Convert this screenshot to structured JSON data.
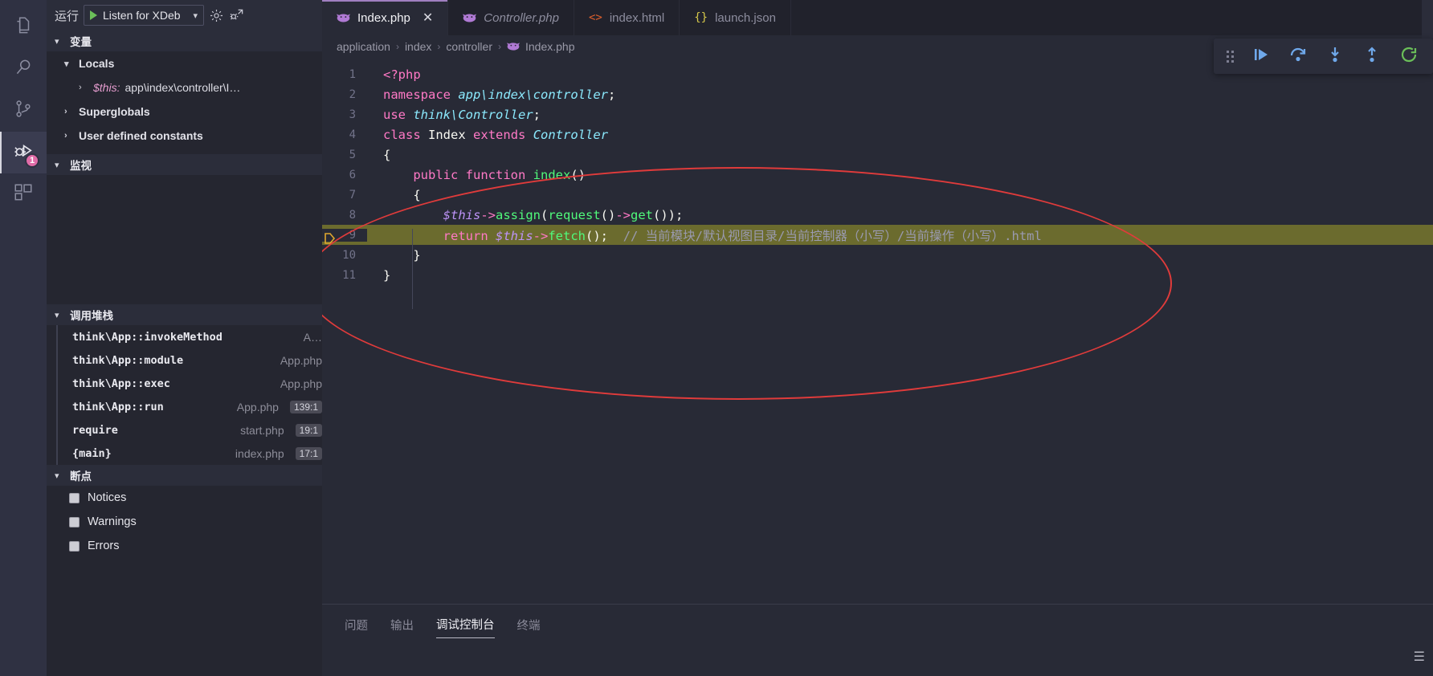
{
  "activitybar": {
    "items": [
      {
        "name": "explorer",
        "icon": "files-icon",
        "active": false
      },
      {
        "name": "search",
        "icon": "search-icon",
        "active": false
      },
      {
        "name": "source-control",
        "icon": "source-control-icon",
        "active": false
      },
      {
        "name": "run-and-debug",
        "icon": "debug-icon",
        "active": true,
        "badge": "1"
      },
      {
        "name": "extensions",
        "icon": "extensions-icon",
        "active": false
      }
    ]
  },
  "sidebar": {
    "run_label": "运行",
    "configuration": "Listen for XDeb",
    "gear_icon": "gear-icon",
    "open_debug_icon": "open-debug-console-icon",
    "sections": {
      "variables": {
        "title": "变量",
        "rows": [
          {
            "label": "Locals",
            "twisty": "⌄",
            "bold": true,
            "indent": 0
          },
          {
            "label": "$this:",
            "value": "app\\index\\controller\\I…",
            "twisty": "›",
            "bold": false,
            "indent": 1,
            "isVar": true
          },
          {
            "label": "Superglobals",
            "twisty": "›",
            "bold": true,
            "indent": 0
          },
          {
            "label": "User defined constants",
            "twisty": "›",
            "bold": true,
            "indent": 0
          }
        ]
      },
      "watch": {
        "title": "监视",
        "rows": []
      },
      "callstack": {
        "title": "调用堆栈",
        "rows": [
          {
            "name": "think\\App::invokeMethod",
            "file": "A…",
            "line": ""
          },
          {
            "name": "think\\App::module",
            "file": "App.php",
            "line": ""
          },
          {
            "name": "think\\App::exec",
            "file": "App.php",
            "line": ""
          },
          {
            "name": "think\\App::run",
            "file": "App.php",
            "line": "139:1"
          },
          {
            "name": "require",
            "file": "start.php",
            "line": "19:1"
          },
          {
            "name": "{main}",
            "file": "index.php",
            "line": "17:1"
          }
        ]
      },
      "breakpoints": {
        "title": "断点",
        "rows": [
          {
            "label": "Notices",
            "checked": false
          },
          {
            "label": "Warnings",
            "checked": false
          },
          {
            "label": "Errors",
            "checked": false
          }
        ]
      }
    }
  },
  "editor": {
    "tabs": [
      {
        "label": "Index.php",
        "icon": "php-icon",
        "active": true,
        "italic": false,
        "closable": true
      },
      {
        "label": "Controller.php",
        "icon": "php-icon",
        "active": false,
        "italic": true,
        "closable": false
      },
      {
        "label": "index.html",
        "icon": "html-icon",
        "active": false,
        "italic": false,
        "closable": false
      },
      {
        "label": "launch.json",
        "icon": "json-icon",
        "active": false,
        "italic": false,
        "closable": false
      }
    ],
    "breadcrumb": [
      "application",
      "index",
      "controller",
      "Index.php"
    ],
    "breadcrumb_separator": "›",
    "lines": [
      {
        "num": "1",
        "highlight": false,
        "breakpoint": false,
        "tokens": [
          {
            "t": "tag",
            "s": "<?php"
          }
        ]
      },
      {
        "num": "2",
        "highlight": false,
        "breakpoint": false,
        "tokens": [
          {
            "t": "kw",
            "s": "namespace"
          },
          {
            "t": "plain",
            "s": " "
          },
          {
            "t": "id",
            "s": "app\\index\\controller"
          },
          {
            "t": "pun",
            "s": ";"
          }
        ]
      },
      {
        "num": "3",
        "highlight": false,
        "breakpoint": false,
        "tokens": [
          {
            "t": "kw",
            "s": "use"
          },
          {
            "t": "plain",
            "s": " "
          },
          {
            "t": "id",
            "s": "think\\Controller"
          },
          {
            "t": "pun",
            "s": ";"
          }
        ]
      },
      {
        "num": "4",
        "highlight": false,
        "breakpoint": false,
        "tokens": [
          {
            "t": "kw",
            "s": "class"
          },
          {
            "t": "plain",
            "s": " "
          },
          {
            "t": "plain",
            "s": "Index"
          },
          {
            "t": "plain",
            "s": " "
          },
          {
            "t": "kw",
            "s": "extends"
          },
          {
            "t": "plain",
            "s": " "
          },
          {
            "t": "cls",
            "s": "Controller"
          }
        ]
      },
      {
        "num": "5",
        "highlight": false,
        "breakpoint": false,
        "tokens": [
          {
            "t": "plain",
            "s": "{"
          }
        ]
      },
      {
        "num": "6",
        "highlight": false,
        "breakpoint": false,
        "tokens": [
          {
            "t": "plain",
            "s": "    "
          },
          {
            "t": "kw",
            "s": "public"
          },
          {
            "t": "plain",
            "s": " "
          },
          {
            "t": "kw",
            "s": "function"
          },
          {
            "t": "plain",
            "s": " "
          },
          {
            "t": "fn",
            "s": "index"
          },
          {
            "t": "pun",
            "s": "()"
          }
        ]
      },
      {
        "num": "7",
        "highlight": false,
        "breakpoint": false,
        "tokens": [
          {
            "t": "plain",
            "s": "    {"
          }
        ]
      },
      {
        "num": "8",
        "highlight": false,
        "breakpoint": false,
        "tokens": [
          {
            "t": "plain",
            "s": "        "
          },
          {
            "t": "var",
            "s": "$this"
          },
          {
            "t": "op",
            "s": "->"
          },
          {
            "t": "fn",
            "s": "assign"
          },
          {
            "t": "pun",
            "s": "("
          },
          {
            "t": "fn",
            "s": "request"
          },
          {
            "t": "pun",
            "s": "()"
          },
          {
            "t": "op",
            "s": "->"
          },
          {
            "t": "fn",
            "s": "get"
          },
          {
            "t": "pun",
            "s": "());"
          }
        ]
      },
      {
        "num": "9",
        "highlight": true,
        "breakpoint": true,
        "tokens": [
          {
            "t": "plain",
            "s": "        "
          },
          {
            "t": "kw",
            "s": "return"
          },
          {
            "t": "plain",
            "s": " "
          },
          {
            "t": "var",
            "s": "$this"
          },
          {
            "t": "op",
            "s": "->"
          },
          {
            "t": "fn",
            "s": "fetch"
          },
          {
            "t": "pun",
            "s": "();"
          },
          {
            "t": "plain",
            "s": "  "
          },
          {
            "t": "cmt",
            "s": "// 当前模块/默认视图目录/当前控制器（小写）/当前操作（小写）.html"
          }
        ]
      },
      {
        "num": "10",
        "highlight": false,
        "breakpoint": false,
        "tokens": [
          {
            "t": "plain",
            "s": "    }"
          }
        ]
      },
      {
        "num": "11",
        "highlight": false,
        "breakpoint": false,
        "tokens": [
          {
            "t": "plain",
            "s": "}"
          }
        ]
      }
    ]
  },
  "debug_toolbar": {
    "buttons": [
      {
        "name": "drag-handle",
        "icon": "grip-icon"
      },
      {
        "name": "continue",
        "icon": "continue-icon",
        "color": "#6fa8ea"
      },
      {
        "name": "step-over",
        "icon": "step-over-icon",
        "color": "#6fa8ea"
      },
      {
        "name": "step-into",
        "icon": "step-into-icon",
        "color": "#6fa8ea"
      },
      {
        "name": "step-out",
        "icon": "step-out-icon",
        "color": "#6fa8ea"
      },
      {
        "name": "restart",
        "icon": "restart-icon",
        "color": "#6bbf59"
      }
    ]
  },
  "panel": {
    "tabs": [
      {
        "label": "问题",
        "active": false
      },
      {
        "label": "输出",
        "active": false
      },
      {
        "label": "调试控制台",
        "active": true
      },
      {
        "label": "终端",
        "active": false
      }
    ],
    "hamburger_icon": "menu-icon"
  },
  "colors": {
    "accent": "#a07fc0",
    "highlight_line": "#6b6b2e",
    "annotation": "#e03b3b",
    "badge": "#e06ca8",
    "editor_bg": "#282a36",
    "sidebar_bg": "#252630"
  }
}
